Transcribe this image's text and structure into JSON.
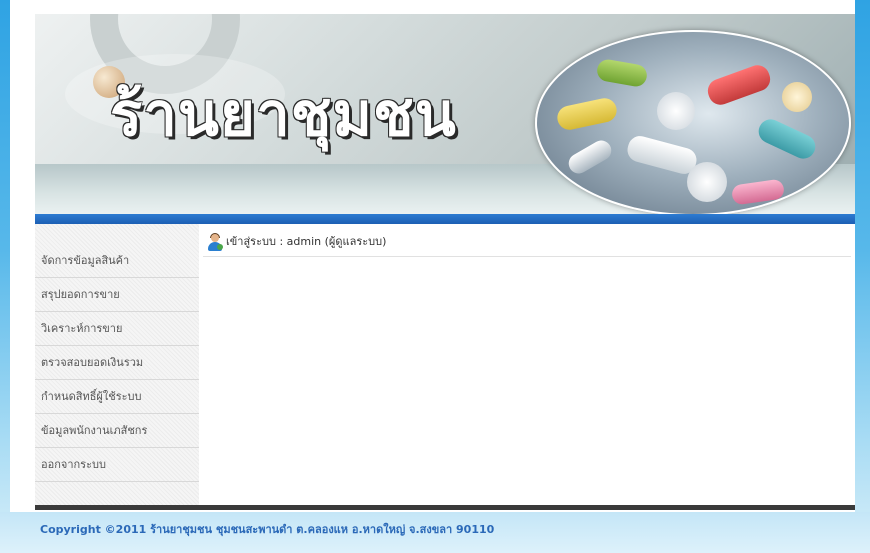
{
  "header": {
    "logo_text": "ร้านยาชุมชน"
  },
  "sidebar": {
    "items": [
      {
        "label": "จัดการข้อมูลสินค้า"
      },
      {
        "label": "สรุปยอดการขาย"
      },
      {
        "label": "วิเคราะห์การขาย"
      },
      {
        "label": "ตรวจสอบยอดเงินรวม"
      },
      {
        "label": "กำหนดสิทธิ์ผู้ใช้ระบบ"
      },
      {
        "label": "ข้อมูลพนักงานเภสัชกร"
      },
      {
        "label": "ออกจากระบบ"
      }
    ]
  },
  "main": {
    "login_status": "เข้าสู่ระบบ : admin (ผู้ดูแลระบบ)",
    "icon": "user-icon"
  },
  "footer": {
    "copyright": "Copyright ©2011 ร้านยาชุมชน ชุมชนสะพานดำ ต.คลองแห อ.หาดใหญ่ จ.สงขลา 90110"
  },
  "colors": {
    "accent_blue": "#1c5fb3",
    "frame_blue": "#2fa3e3",
    "footer_text": "#2b69b8"
  }
}
